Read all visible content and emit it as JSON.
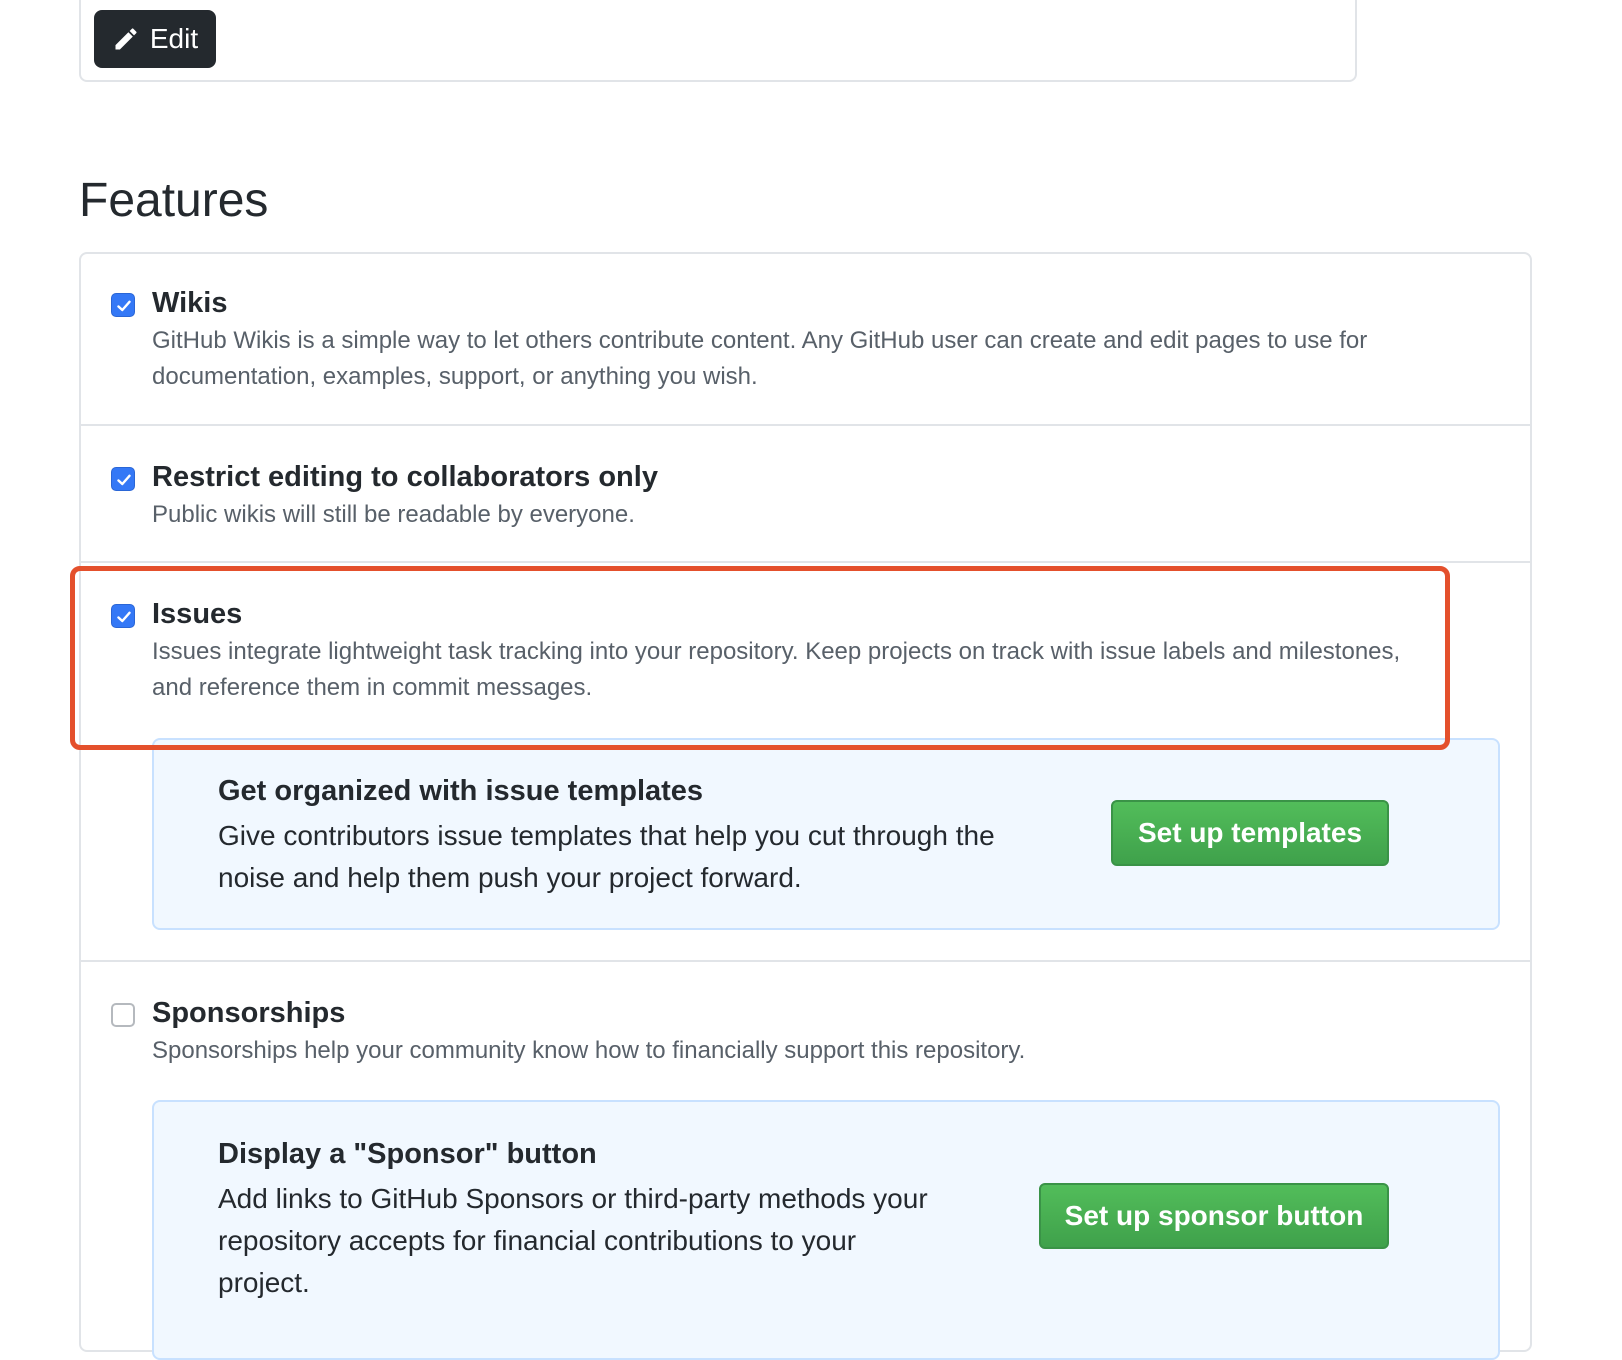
{
  "toolbar": {
    "edit_label": "Edit"
  },
  "features": {
    "title": "Features",
    "items": [
      {
        "title": "Wikis",
        "checked": true,
        "description_lines": [
          "GitHub Wikis is a simple way to let others contribute content. Any GitHub user can create and edit pages to use for",
          "documentation, examples, support, or anything you wish."
        ]
      },
      {
        "title": "Restrict editing to collaborators only",
        "checked": true,
        "description_lines": [
          "Public wikis will still be readable by everyone."
        ]
      },
      {
        "title": "Issues",
        "checked": true,
        "description_lines": [
          "Issues integrate lightweight task tracking into your repository. Keep projects on track with issue labels and milestones,",
          "and reference them in commit messages."
        ],
        "promo": {
          "title": "Get organized with issue templates",
          "description_lines": [
            "Give contributors issue templates that help you cut through the",
            "noise and help them push your project forward."
          ],
          "button_label": "Set up templates"
        }
      },
      {
        "title": "Sponsorships",
        "checked": false,
        "description_lines": [
          "Sponsorships help your community know how to financially support this repository."
        ],
        "promo": {
          "title": "Display a \"Sponsor\" button",
          "description_lines": [
            "Add links to GitHub Sponsors or third-party methods your",
            "repository accepts for financial contributions to your",
            "project."
          ],
          "button_label": "Set up sponsor button"
        }
      }
    ]
  },
  "colors": {
    "checkbox_checked": "#3478f6",
    "primary_button": "#44a84f",
    "highlight_annotation": "#e4502c",
    "edit_button": "#24292e",
    "promo_background": "#f1f8ff"
  }
}
